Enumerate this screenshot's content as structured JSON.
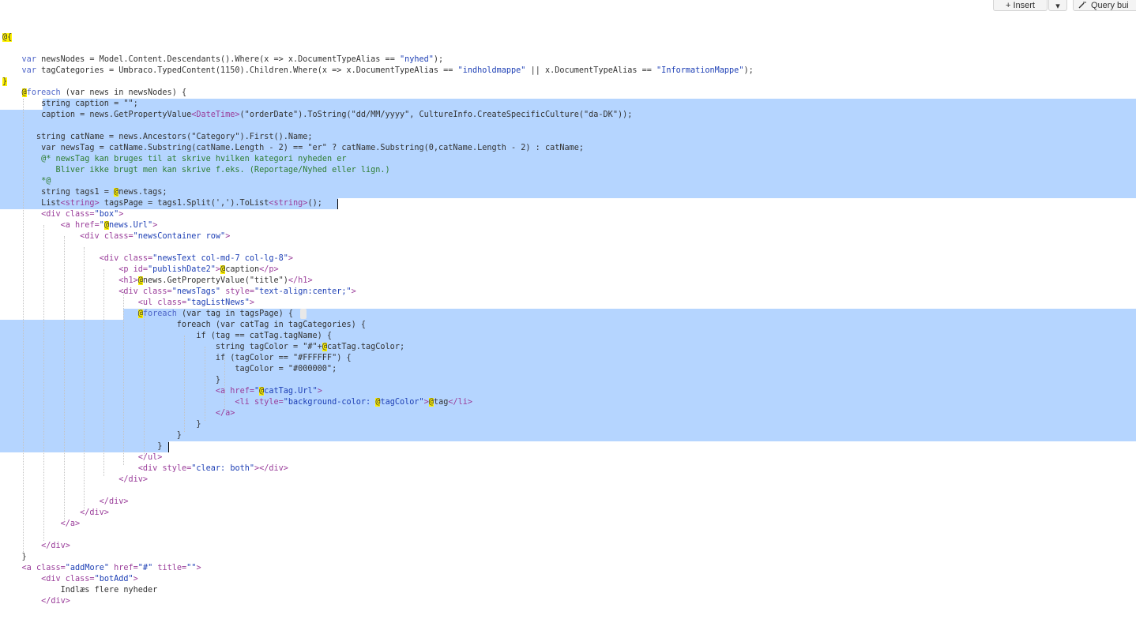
{
  "toolbar": {
    "insert_icon": "plus-icon",
    "insert_label": "+ Insert",
    "dropdown_icon": "caret-down-icon",
    "dropdown_label": "▾",
    "query_icon": "wand-icon",
    "query_label": "Query bui"
  },
  "colors": {
    "selection": "#b5d5ff",
    "razor_highlight": "#fff200",
    "keyword": "#4f66c9",
    "markup_tag": "#9a3d9a",
    "string": "#1d3fb5",
    "comment": "#2e7d32"
  },
  "code": {
    "lines": [
      [
        [
          "@{",
          "hl"
        ]
      ],
      [],
      [
        [
          "    "
        ],
        [
          "var",
          "kw"
        ],
        [
          " newsNodes = Model.Content.Descendants().Where(x => x.DocumentTypeAlias == "
        ],
        [
          "\"nyhed\"",
          "str"
        ],
        [
          ");"
        ]
      ],
      [
        [
          "    "
        ],
        [
          "var",
          "kw"
        ],
        [
          " tagCategories = Umbraco.TypedContent(1150).Children.Where(x => x.DocumentTypeAlias == "
        ],
        [
          "\"indholdmappe\"",
          "str"
        ],
        [
          " || x.DocumentTypeAlias == "
        ],
        [
          "\"InformationMappe\"",
          "str"
        ],
        [
          ");"
        ]
      ],
      [
        [
          "}",
          "hl"
        ]
      ],
      [
        [
          "    "
        ],
        [
          "@",
          "hl"
        ],
        [
          "foreach",
          "kw"
        ],
        [
          " (var news in newsNodes) {"
        ]
      ],
      [
        [
          "        string caption = \"\";"
        ]
      ],
      [
        [
          "        caption = news.GetPropertyValue"
        ],
        [
          "<DateTime>",
          "tag"
        ],
        [
          "(\"orderDate\").ToString(\"dd/MM/yyyy\", CultureInfo.CreateSpecificCulture(\"da-DK\"));"
        ]
      ],
      [],
      [
        [
          "       string catName = news.Ancestors(\"Category\").First().Name;"
        ]
      ],
      [
        [
          "        var newsTag = catName.Substring(catName.Length - 2) == \"er\" ? catName.Substring(0,catName.Length - 2) : catName;"
        ]
      ],
      [
        [
          "        "
        ],
        [
          "@* newsTag kan bruges til at skrive hvilken kategori nyheden er",
          "cmt"
        ]
      ],
      [
        [
          "           Bliver ikke brugt men kan skrive f.eks. (Reportage/Nyhed eller lign.)",
          "cmt"
        ]
      ],
      [
        [
          "        *@",
          "cmt"
        ]
      ],
      [
        [
          "        string tags1 = "
        ],
        [
          "@",
          "hl"
        ],
        [
          "news.tags;"
        ]
      ],
      [
        [
          "        List"
        ],
        [
          "<string>",
          "tag"
        ],
        [
          " tagsPage = tags1.Split(',').ToList"
        ],
        [
          "<string>",
          "tag"
        ],
        [
          "();"
        ]
      ],
      [
        [
          "        "
        ],
        [
          "<div",
          "tag"
        ],
        [
          " "
        ],
        [
          "class=",
          "tag"
        ],
        [
          "\"box\"",
          "str"
        ],
        [
          ">",
          "tag"
        ]
      ],
      [
        [
          "            "
        ],
        [
          "<a",
          "tag"
        ],
        [
          " "
        ],
        [
          "href=",
          "tag"
        ],
        [
          "\"",
          "str"
        ],
        [
          "@",
          "hl"
        ],
        [
          "news.Url\"",
          "str"
        ],
        [
          ">",
          "tag"
        ]
      ],
      [
        [
          "                "
        ],
        [
          "<div",
          "tag"
        ],
        [
          " "
        ],
        [
          "class=",
          "tag"
        ],
        [
          "\"newsContainer row\"",
          "str"
        ],
        [
          ">",
          "tag"
        ]
      ],
      [],
      [
        [
          "                    "
        ],
        [
          "<div",
          "tag"
        ],
        [
          " "
        ],
        [
          "class=",
          "tag"
        ],
        [
          "\"newsText col-md-7 col-lg-8\"",
          "str"
        ],
        [
          ">",
          "tag"
        ]
      ],
      [
        [
          "                        "
        ],
        [
          "<p",
          "tag"
        ],
        [
          " "
        ],
        [
          "id=",
          "tag"
        ],
        [
          "\"publishDate2\"",
          "str"
        ],
        [
          ">",
          "tag"
        ],
        [
          "@",
          "hl"
        ],
        [
          "caption"
        ],
        [
          "</p>",
          "tag"
        ]
      ],
      [
        [
          "                        "
        ],
        [
          "<h1>",
          "tag"
        ],
        [
          "@",
          "hl"
        ],
        [
          "news.GetPropertyValue(\"title\")"
        ],
        [
          "</h1>",
          "tag"
        ]
      ],
      [
        [
          "                        "
        ],
        [
          "<div",
          "tag"
        ],
        [
          " "
        ],
        [
          "class=",
          "tag"
        ],
        [
          "\"newsTags\"",
          "str"
        ],
        [
          " "
        ],
        [
          "style=",
          "tag"
        ],
        [
          "\"text-align:center;\"",
          "str"
        ],
        [
          ">",
          "tag"
        ]
      ],
      [
        [
          "                            "
        ],
        [
          "<ul",
          "tag"
        ],
        [
          " "
        ],
        [
          "class=",
          "tag"
        ],
        [
          "\"tagListNews\"",
          "str"
        ],
        [
          ">",
          "tag"
        ]
      ],
      [
        [
          "                            "
        ],
        [
          "@",
          "hl"
        ],
        [
          "foreach",
          "kw"
        ],
        [
          " (var tag in tagsPage) {"
        ]
      ],
      [
        [
          "                                    foreach (var catTag in tagCategories) {"
        ]
      ],
      [
        [
          "                                        if (tag == catTag.tagName) {"
        ]
      ],
      [
        [
          "                                            string tagColor = \"#\"+"
        ],
        [
          "@",
          "hl"
        ],
        [
          "catTag.tagColor;"
        ]
      ],
      [
        [
          "                                            if (tagColor == \"#FFFFFF\") {"
        ]
      ],
      [
        [
          "                                                tagColor = \"#000000\";"
        ]
      ],
      [
        [
          "                                            }"
        ]
      ],
      [
        [
          "                                            "
        ],
        [
          "<a",
          "tag"
        ],
        [
          " "
        ],
        [
          "href=",
          "tag"
        ],
        [
          "\"",
          "str"
        ],
        [
          "@",
          "hl"
        ],
        [
          "catTag.Url\"",
          "str"
        ],
        [
          ">",
          "tag"
        ]
      ],
      [
        [
          "                                                "
        ],
        [
          "<li",
          "tag"
        ],
        [
          " "
        ],
        [
          "style=",
          "tag"
        ],
        [
          "\"background-color: ",
          "str"
        ],
        [
          "@",
          "hl"
        ],
        [
          "tagColor\"",
          "str"
        ],
        [
          ">",
          "tag"
        ],
        [
          "@",
          "hl"
        ],
        [
          "tag"
        ],
        [
          "</li>",
          "tag"
        ]
      ],
      [
        [
          "                                            "
        ],
        [
          "</a>",
          "tag"
        ]
      ],
      [
        [
          "                                        }"
        ]
      ],
      [
        [
          "                                    }"
        ]
      ],
      [
        [
          "                                }"
        ]
      ],
      [
        [
          "                            "
        ],
        [
          "</ul>",
          "tag"
        ]
      ],
      [
        [
          "                            "
        ],
        [
          "<div",
          "tag"
        ],
        [
          " "
        ],
        [
          "style=",
          "tag"
        ],
        [
          "\"clear: both\"",
          "str"
        ],
        [
          ">",
          "tag"
        ],
        [
          "</div>",
          "tag"
        ]
      ],
      [
        [
          "                        "
        ],
        [
          "</div>",
          "tag"
        ]
      ],
      [],
      [
        [
          "                    "
        ],
        [
          "</div>",
          "tag"
        ]
      ],
      [
        [
          "                "
        ],
        [
          "</div>",
          "tag"
        ]
      ],
      [
        [
          "            "
        ],
        [
          "</a>",
          "tag"
        ]
      ],
      [],
      [
        [
          "        "
        ],
        [
          "</div>",
          "tag"
        ]
      ],
      [
        [
          "    }"
        ]
      ],
      [
        [
          "    "
        ],
        [
          "<a",
          "tag"
        ],
        [
          " "
        ],
        [
          "class=",
          "tag"
        ],
        [
          "\"addMore\"",
          "str"
        ],
        [
          " "
        ],
        [
          "href=",
          "tag"
        ],
        [
          "\"#\"",
          "str"
        ],
        [
          " "
        ],
        [
          "title=",
          "tag"
        ],
        [
          "\"\"",
          "str"
        ],
        [
          ">",
          "tag"
        ]
      ],
      [
        [
          "        "
        ],
        [
          "<div",
          "tag"
        ],
        [
          " "
        ],
        [
          "class=",
          "tag"
        ],
        [
          "\"botAdd\"",
          "str"
        ],
        [
          ">",
          "tag"
        ]
      ],
      [
        [
          "            Indlæs flere nyheder"
        ]
      ],
      [
        [
          "        "
        ],
        [
          "</div>",
          "tag"
        ]
      ]
    ]
  }
}
